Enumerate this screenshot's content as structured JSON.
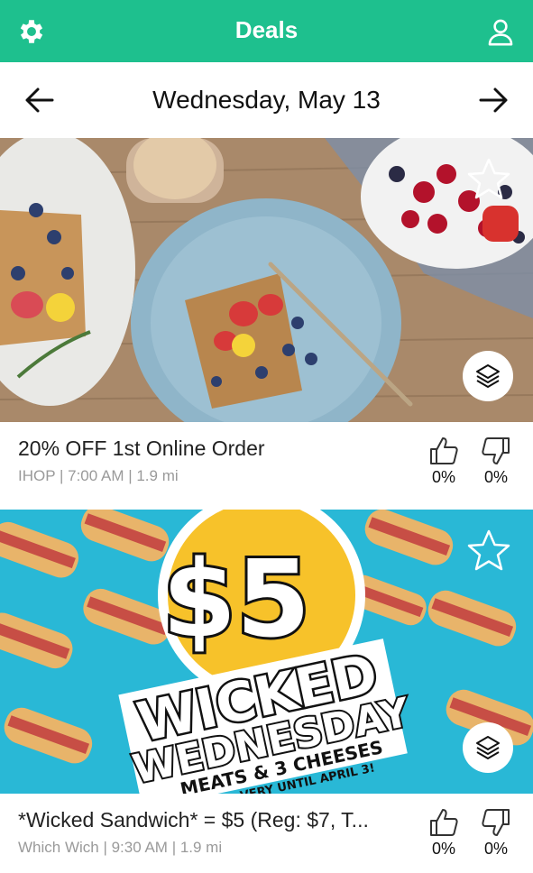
{
  "header": {
    "title": "Deals",
    "settings_icon": "gear-icon",
    "profile_icon": "user-icon"
  },
  "date_nav": {
    "date": "Wednesday, May 13",
    "prev_icon": "arrow-left-icon",
    "next_icon": "arrow-right-icon"
  },
  "deals": [
    {
      "title": "20% OFF 1st Online Order",
      "meta": "IHOP | 7:00 AM | 1.9 mi",
      "like_pct": "0%",
      "dislike_pct": "0%",
      "favorite_icon": "star-icon",
      "more_icon": "layers-icon"
    },
    {
      "title": "*Wicked Sandwich* = $5 (Reg: $7, T...",
      "meta": "Which Wich | 9:30 AM | 1.9 mi",
      "like_pct": "0%",
      "dislike_pct": "0%",
      "favorite_icon": "star-icon",
      "more_icon": "layers-icon",
      "promo_price": "$5",
      "promo_line1": "WICKED",
      "promo_line2": "WEDNESDAY",
      "promo_line3": "MEATS & 3 CHEESES",
      "promo_line4": "VERY UNTIL APRIL 3!"
    }
  ],
  "colors": {
    "brand": "#1ec08e",
    "meta_text": "#9a9a9a",
    "promo_bg": "#29b8d6",
    "promo_yellow": "#f7c22a"
  }
}
